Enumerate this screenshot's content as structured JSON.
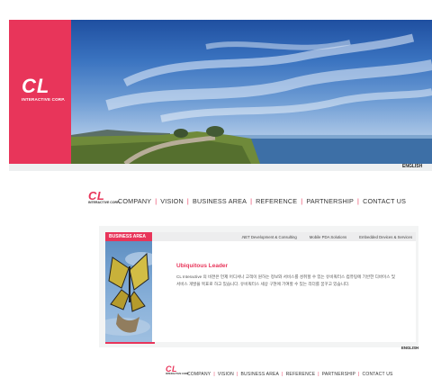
{
  "colors": {
    "accent": "#e8355a",
    "sky": "#3a73c0",
    "panel": "#f3f4f4"
  },
  "hero": {
    "logo_text": "CL",
    "logo_subtitle": "INTERACTIVE CORP.",
    "language": "ENGLISH"
  },
  "nav": {
    "logo_text": "CL",
    "logo_subtitle": "INTERACTIVE CORP.",
    "items": [
      "COMPANY",
      "VISION",
      "BUSINESS AREA",
      "REFERENCE",
      "PARTNERSHIP",
      "CONTACT US"
    ]
  },
  "window": {
    "section_tag": "BUSINESS AREA",
    "menu": [
      ".NET Development & Consulting",
      "Mobile PDA Solutions",
      "Embedded Devices & Services"
    ],
    "title": "Ubiquitous Leader",
    "body_line1": "CL Interactive 의 비젼은 언제 어디서나 고객이 원하는 정보와 서비스를 성취할 수 있는 유비쿼터스 컴퓨팅에 기반한 디바이스 및",
    "body_line2": "서비스 개발을 목표로 하고 있습니다. 유비쿼터스 세상 구현에 기여할 수 있는 리더를 꿈꾸고 있습니다.",
    "language": "ENGLISH"
  },
  "footer_nav": {
    "logo_text": "CL",
    "logo_subtitle": "INTERACTIVE CORP.",
    "items": [
      "COMPANY",
      "VISION",
      "BUSINESS AREA",
      "REFERENCE",
      "PARTNERSHIP",
      "CONTACT US"
    ]
  }
}
